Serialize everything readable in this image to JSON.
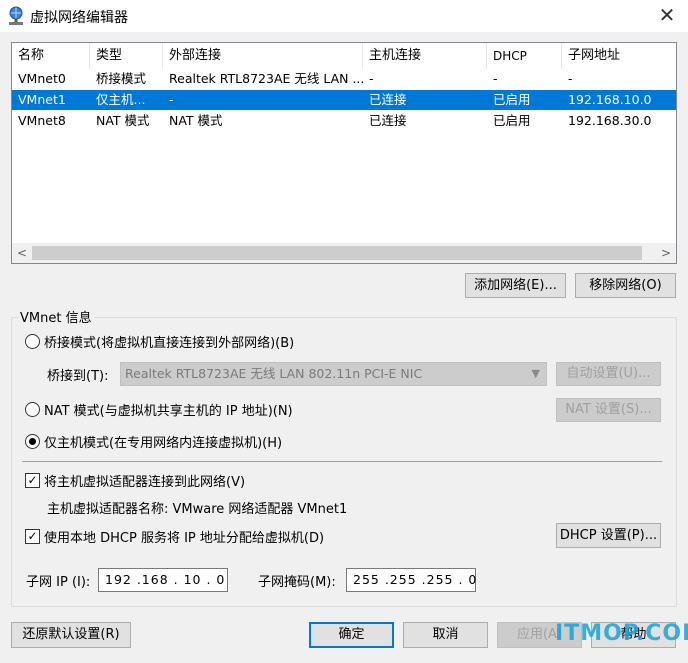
{
  "window": {
    "title": "虚拟网络编辑器",
    "close_glyph": "✕"
  },
  "table": {
    "columns": [
      "名称",
      "类型",
      "外部连接",
      "主机连接",
      "DHCP",
      "子网地址"
    ],
    "rows": [
      [
        "VMnet0",
        "桥接模式",
        "Realtek RTL8723AE 无线 LAN ...",
        "-",
        "-",
        "-"
      ],
      [
        "VMnet1",
        "仅主机...",
        "-",
        "已连接",
        "已启用",
        "192.168.10.0"
      ],
      [
        "VMnet8",
        "NAT 模式",
        "NAT 模式",
        "已连接",
        "已启用",
        "192.168.30.0"
      ]
    ],
    "selected_row": 1,
    "scroll_left": "<",
    "scroll_right": ">"
  },
  "buttons": {
    "add_network": "添加网络(E)...",
    "remove_network": "移除网络(O)",
    "auto_settings": "自动设置(U)...",
    "nat_settings": "NAT 设置(S)...",
    "dhcp_settings": "DHCP 设置(P)...",
    "restore_defaults": "还原默认设置(R)",
    "ok": "确定",
    "cancel": "取消",
    "apply": "应用(A)",
    "help": "帮助"
  },
  "vmnet_info": {
    "legend": "VMnet 信息",
    "bridged_label": "桥接模式(将虚拟机直接连接到外部网络)(B)",
    "bridge_to_label": "桥接到(T):",
    "bridge_to_value": "Realtek RTL8723AE 无线 LAN 802.11n PCI-E NIC",
    "nat_label": "NAT 模式(与虚拟机共享主机的 IP 地址)(N)",
    "hostonly_label": "仅主机模式(在专用网络内连接虚拟机)(H)",
    "mode_selected": "hostonly",
    "connect_adapter_label": "将主机虚拟适配器连接到此网络(V)",
    "connect_adapter_checked": true,
    "adapter_name_label": "主机虚拟适配器名称: VMware 网络适配器 VMnet1",
    "dhcp_label": "使用本地 DHCP 服务将 IP 地址分配给虚拟机(D)",
    "dhcp_checked": true,
    "subnet_ip_label": "子网 IP (I):",
    "subnet_ip_value": "192 .168 . 10  .  0",
    "subnet_mask_label": "子网掩码(M):",
    "subnet_mask_value": "255 .255 .255 .  0"
  },
  "watermark": "ITMOP.COM",
  "colors": {
    "selection": "#0078d7",
    "watermark": "#18a4d8"
  }
}
